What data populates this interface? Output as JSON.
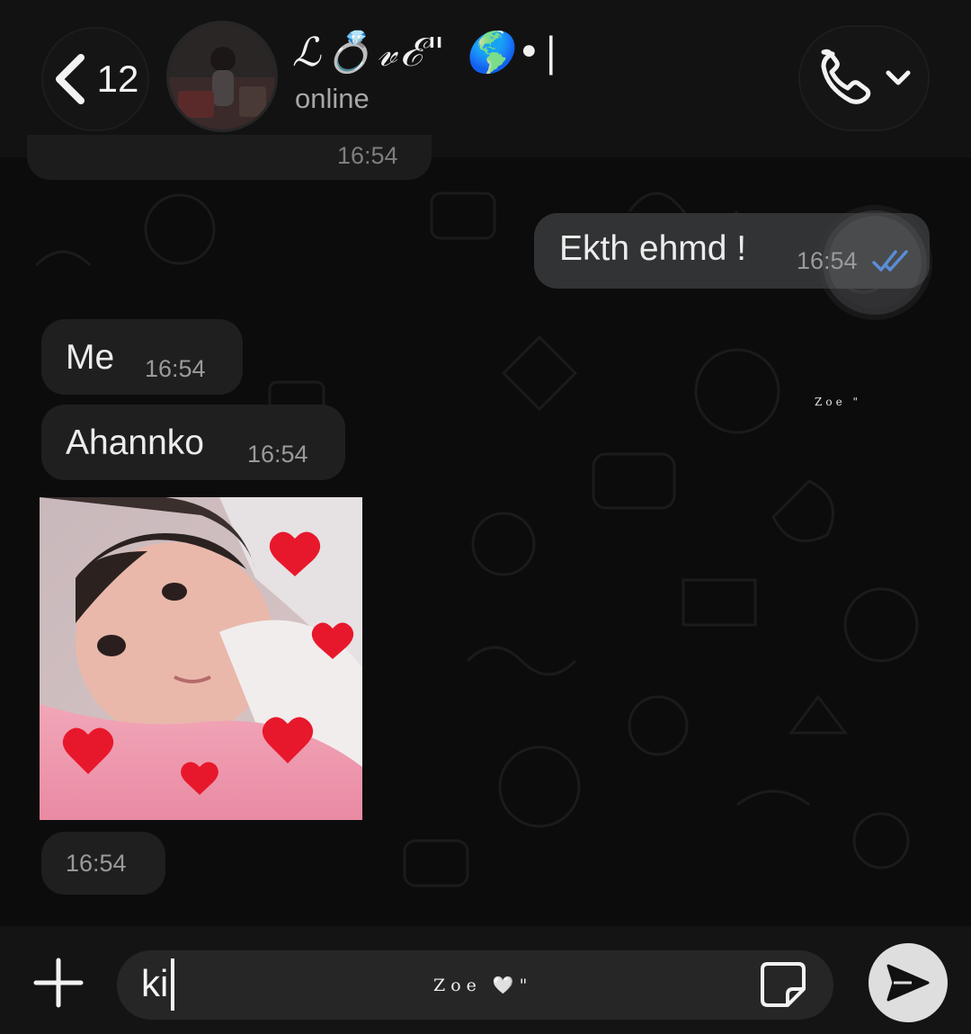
{
  "header": {
    "back_count": "12",
    "contact_name": "ℒ💍𝓋ℰ\" 🌎•|",
    "status": "online"
  },
  "messages": {
    "cut_time": "16:54",
    "out_1": {
      "text": "Ekth ehmd !",
      "time": "16:54"
    },
    "in_1": {
      "text": "Me",
      "time": "16:54"
    },
    "in_2": {
      "text": "Ahannko",
      "time": "16:54"
    },
    "photo_time": "16:54"
  },
  "watermarks": {
    "mid": "Zoe \"",
    "input": "Zoe 🤍\""
  },
  "composer": {
    "input_value": "ki"
  },
  "icons": {
    "back": "chevron-left-icon",
    "call": "phone-icon",
    "call_menu": "chevron-down-icon",
    "attach": "plus-icon",
    "sticker": "sticker-icon",
    "send": "send-icon",
    "read": "double-check-icon"
  },
  "colors": {
    "background": "#0c0c0d",
    "bubble_in": "#1f1f20",
    "bubble_out": "#323335",
    "read_ticks": "#5a8dd6",
    "heart": "#e8182c"
  }
}
